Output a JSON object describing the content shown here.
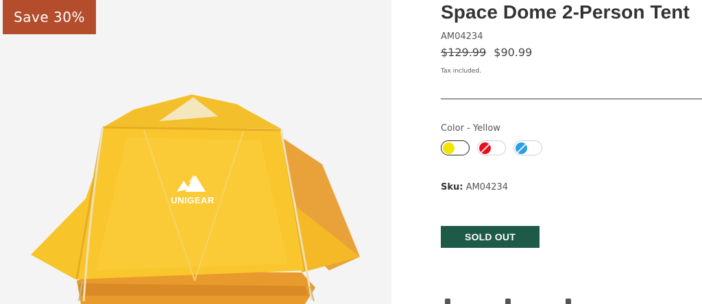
{
  "badge": {
    "label": "Save 30%",
    "color": "#b44d2c"
  },
  "product": {
    "title": "Space Dome 2-Person Tent",
    "model_code": "AM04234",
    "price_original": "$129.99",
    "price_sale": "$90.99",
    "tax_note": "Tax included.",
    "image_brand": "UNIGEAR"
  },
  "color": {
    "label": "Color - Yellow",
    "options": [
      {
        "name": "Yellow",
        "hex": "#f2e600",
        "selected": true
      },
      {
        "name": "Red",
        "hex": "#e3101e",
        "selected": false
      },
      {
        "name": "Blue",
        "hex": "#2aa0e6",
        "selected": false
      }
    ]
  },
  "sku": {
    "label": "Sku:",
    "value": "AM04234"
  },
  "actions": {
    "sold_out_label": "SOLD OUT",
    "button_color": "#1e5a48"
  },
  "icons": [
    "facebook-icon",
    "twitter-icon",
    "pinterest-icon"
  ]
}
